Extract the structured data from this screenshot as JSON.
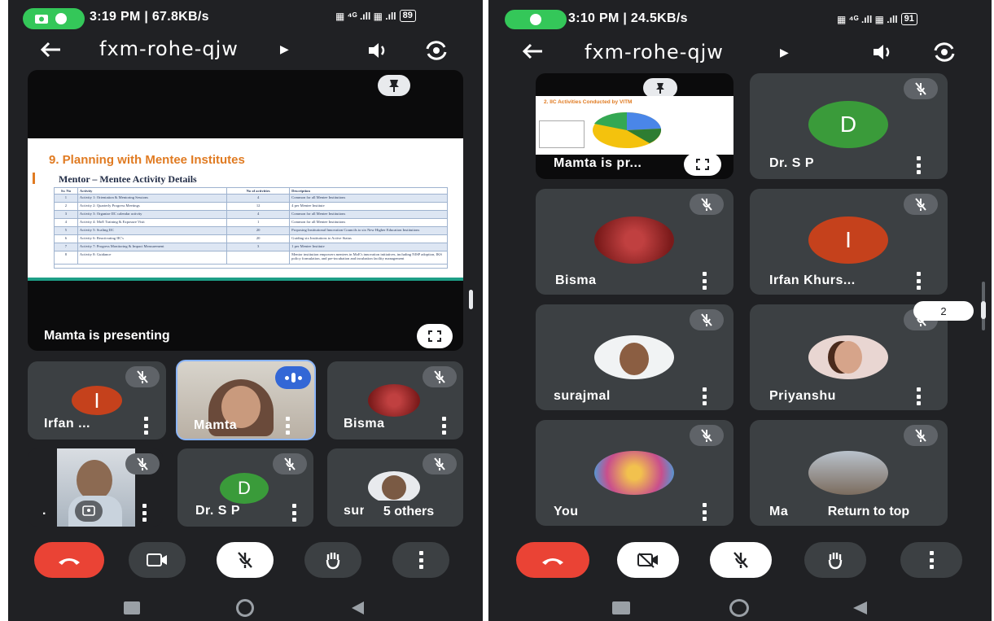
{
  "left": {
    "status": {
      "time": "3:19 PM | 67.8KB/s",
      "battery": "89"
    },
    "meeting_code": "fxm-rohe-qjw",
    "presentation": {
      "slide_title": "9. Planning with Mentee Institutes",
      "slide_subtitle": "Mentor – Mentee Activity Details",
      "caption": "Mamta is presenting",
      "headers": [
        "Sr. No",
        "Activity",
        "No of activities",
        "Description"
      ],
      "rows": [
        [
          "1",
          "Activity 1: Orientation & Mentoring Sessions",
          "4",
          "Common for all Mentee Institutions"
        ],
        [
          "2",
          "Activity 2: Quarterly Progress Meetings",
          "12",
          "4 per Mentee Institute"
        ],
        [
          "3",
          "Activity 3: Organize IIC calendar activity",
          "4",
          "Common for all Mentee Institutions"
        ],
        [
          "4",
          "Activity 4: MoE Training & Exposure Visit",
          "1",
          "Common for all Mentee Institutions"
        ],
        [
          "5",
          "Activity 5: Scaling IIC",
          "20",
          "Proposing Institutional Innovation Councils to six New Higher Education Institutions"
        ],
        [
          "6",
          "Activity 6: Reactivating IIC's",
          "20",
          "Guiding six Institutions to Active Status"
        ],
        [
          "7",
          "Activity 7: Progress Monitoring & Impact Measurement",
          "3",
          "1 per Mentee Institute"
        ],
        [
          "8",
          "Activity 8: Guidance",
          "",
          "Mentor institution empowers mentees in MoE's innovation initiatives, including NISP adoption, IKS policy formulation, and pre-incubation and incubation facility management"
        ]
      ]
    },
    "tiles": [
      {
        "name": "Irfan ...",
        "initial": "I",
        "color": "#c5411c"
      },
      {
        "name": "Mamta"
      },
      {
        "name": "Bisma"
      },
      {
        "name": "."
      },
      {
        "name": "Dr. S P",
        "initial": "D",
        "color": "#3a9b3a"
      },
      {
        "name": "sur",
        "overflow": "5 others"
      }
    ]
  },
  "right": {
    "status": {
      "time": "3:10 PM | 24.5KB/s",
      "battery": "91"
    },
    "meeting_code": "fxm-rohe-qjw",
    "mini_slide_title": "2. IIC Activities Conducted by VITM",
    "tiles": [
      {
        "name": "Mamta is pr..."
      },
      {
        "name": "Dr. S P",
        "initial": "D",
        "color": "#3a9b3a"
      },
      {
        "name": "Bisma"
      },
      {
        "name": "Irfan Khurs...",
        "initial": "I",
        "color": "#c5411c"
      },
      {
        "name": "surajmal"
      },
      {
        "name": "Priyanshu"
      },
      {
        "name": "You"
      },
      {
        "name": "Ma",
        "overlay": "Return to top"
      }
    ],
    "scroll_badge": "2"
  },
  "colors": {
    "end_call": "#ea4335",
    "bg": "#202124",
    "tile": "#3c4043",
    "accent": "#8ab4f8"
  }
}
